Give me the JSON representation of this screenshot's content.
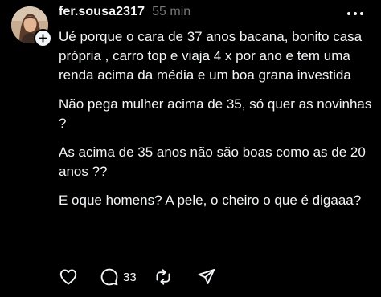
{
  "post": {
    "username": "fer.sousa2317",
    "timestamp": "55 min",
    "paragraphs": [
      "Ué porque o cara de 37 anos bacana, bonito casa própria , carro top e viaja 4 x por ano e tem uma renda acima da média e um boa grana investida",
      "Não pega mulher acima de 35, só quer as novinhas ?",
      "As acima de 35 anos não são boas como as de 20 anos ??",
      "E oque homens? A pele, o cheiro o que é digaaa?"
    ],
    "actions": {
      "reply_count": "33"
    }
  },
  "icons": {
    "more": "more-horizontal-icon",
    "follow": "plus-icon",
    "like": "heart-icon",
    "reply": "comment-bubble-icon",
    "repost": "repost-icon",
    "share": "send-icon"
  },
  "colors": {
    "background": "#000000",
    "text": "#f3f5f7",
    "secondary_text": "#777777"
  }
}
